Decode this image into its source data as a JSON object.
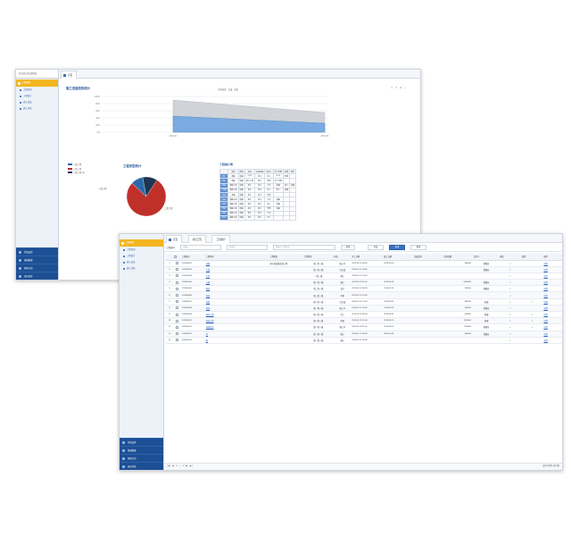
{
  "back": {
    "sidebar": {
      "header": "综合办公信息系统",
      "active": "工程管理",
      "items": [
        "工程查询",
        "工程统计",
        "施工进度",
        "施工台账"
      ],
      "bottom": [
        "系统设置",
        "基础数据",
        "帮助文档",
        "退出系统"
      ]
    },
    "tabs": [
      "首页"
    ],
    "area_chart": {
      "title": "施工进度趋势统计",
      "legend": [
        "计划进度",
        "完成",
        "实际"
      ],
      "tools": "⊙ ≡ ⊕ ⤓"
    },
    "pie": {
      "title": "工程类型统计",
      "legend": [
        "一类工程",
        "二类工程",
        "三类工程 (1)"
      ],
      "labels": [
        "一类工程",
        "二类工程"
      ]
    },
    "table": {
      "title": "工程统计表",
      "headers": [
        "",
        "名称",
        "类型",
        "状态",
        "完成金额",
        "负责人",
        "生产日期",
        "创建",
        "操作"
      ],
      "rows": [
        [
          "工程一",
          "道路",
          "道路",
          "2019",
          "施工",
          "张三",
          "2019",
          "创建",
          ""
        ],
        [
          "工程二",
          "道路",
          "道路",
          "施工工程",
          "施工",
          "李四",
          "生产日期",
          "",
          ""
        ],
        [
          "工程三",
          "道路工程",
          "道路",
          "施工",
          "施工",
          "王五",
          "道路",
          "施工",
          "道路"
        ],
        [
          "工程四",
          "道路工程",
          "道路",
          "施工",
          "施工",
          "张三",
          "施工",
          "道路",
          ""
        ],
        [
          "工程五",
          "道路",
          "道路",
          "施工",
          "施工",
          "李四",
          "",
          "",
          ""
        ],
        [
          "工程六",
          "道路工程",
          "道路",
          "施工",
          "施工",
          "王五",
          "道路",
          "",
          ""
        ],
        [
          "工程七",
          "道路工程",
          "道路",
          "施工",
          "施工",
          "张三",
          "道路",
          "",
          ""
        ],
        [
          "工程八",
          "道路工程",
          "道路",
          "施工",
          "施工",
          "李四",
          "道路",
          "",
          ""
        ],
        [
          "工程九",
          "道路工程",
          "道路",
          "施工",
          "施工",
          "王五",
          "",
          "",
          ""
        ],
        [
          "工程十",
          "道路工程",
          "道路",
          "施工",
          "施工",
          "张三",
          "",
          "",
          ""
        ]
      ]
    }
  },
  "front": {
    "sidebar": {
      "active": "工程管理",
      "items": [
        "工程查询",
        "工程统计",
        "施工进度",
        "施工台账"
      ],
      "bottom": [
        "系统设置",
        "基础数据",
        "帮助文档",
        "退出系统"
      ]
    },
    "tabs": [
      "首页",
      "项目工程",
      "工程统计"
    ],
    "toolbar": {
      "label": "工程编号",
      "input1": "请输入",
      "input2": "请选择",
      "input3": "请输入工程名称",
      "btn1": "查询",
      "btn2": "导出",
      "btn3": "新增",
      "btn4": "更多"
    },
    "grid": {
      "headers": [
        "",
        "",
        "工程编号",
        "工程名称",
        "",
        "工程地址",
        "工程类型",
        "状态",
        "开工日期",
        "竣工日期",
        "完成日期",
        "合同金额",
        "负责人",
        "审核",
        "验收",
        "操作"
      ],
      "rows": [
        [
          "1",
          "201900001",
          "道路",
          "南大桥道路改造工程",
          "第一类一级",
          "施工中",
          "2019-01-10 08:00",
          "2019-06-30",
          "",
          "980000",
          "管理员",
          "✓",
          "",
          "详情"
        ],
        [
          "2",
          "201900002",
          "大桥",
          "",
          "第一类一级",
          "已完成",
          "2019-01-11 09:00",
          "",
          "",
          "",
          "管理员",
          "✓",
          "",
          "详情"
        ],
        [
          "3",
          "201900003",
          "水利",
          "",
          "一类一级",
          "施工",
          "2019-01-12 10:00",
          "",
          "",
          "",
          "",
          "✓",
          "",
          "详情"
        ],
        [
          "4",
          "201900004",
          "公路",
          "",
          "第一类一级",
          "施工",
          "2019-01-13 11:00",
          "2019-06-30",
          "",
          "2300000",
          "管理员",
          "✓",
          "",
          "详情"
        ],
        [
          "5",
          "201900005",
          "隧道",
          "",
          "第二类一级",
          "设计",
          "2019-01-14 08:30",
          "2019-07-01",
          "",
          "560000",
          "管理员",
          "✓",
          "",
          "详情"
        ],
        [
          "6",
          "201900006",
          "桥梁",
          "",
          "第二类一级",
          "待审",
          "2019-01-15 14:00",
          "",
          "",
          "",
          "",
          "✓",
          "",
          "详情"
        ],
        [
          "7",
          "201900007",
          "道路",
          "",
          "第一类一级",
          "已完成",
          "2019-01-16 15:00",
          "2019-08-01",
          "",
          "880000",
          "普通",
          "✓",
          "✓",
          "详情"
        ],
        [
          "8",
          "201900008",
          "管道",
          "",
          "第一类一级",
          "施工中",
          "2019-01-17 16:00",
          "2019-08-15",
          "",
          "420000",
          "管理员",
          "✓",
          "",
          "详情"
        ],
        [
          "9",
          "201900009",
          "绿化工程",
          "",
          "第一类一级",
          "完工",
          "2019-01-18 09:00",
          "2019-09-01",
          "",
          "330000",
          "普通",
          "✓",
          "✓",
          "详情"
        ],
        [
          "10",
          "201900010",
          "改造工程",
          "",
          "第一类一级",
          "审核",
          "2019-01-19 10:00",
          "2019-09-10",
          "",
          "1200000",
          "普通",
          "✓",
          "✓",
          "详情"
        ],
        [
          "11",
          "201900011",
          "道路改造",
          "",
          "第一类一级",
          "施工中",
          "2019-01-20 11:00",
          "2019-09-20",
          "",
          "7700000",
          "管理员",
          "✓",
          "✓",
          "详情"
        ],
        [
          "12",
          "201900012",
          "桥",
          "",
          "第一类一级",
          "施工",
          "2019-01-21 08:00",
          "2019-10-01",
          "",
          "450000",
          "管理员",
          "✓",
          "",
          "详情"
        ],
        [
          "13",
          "201900013",
          "路",
          "",
          "第一类一级",
          "施工",
          "2019-01-22 08:00",
          "",
          "",
          "",
          "",
          "✓",
          "",
          "详情"
        ]
      ]
    },
    "pager": {
      "nav": "|◀ ◀ 1 / 1 ▶ ▶|",
      "info": "显示1到13,共13条"
    }
  },
  "chart_data": [
    {
      "type": "area",
      "title": "施工进度趋势统计",
      "x": [
        "2019-01",
        "2019-06"
      ],
      "series": [
        {
          "name": "计划进度",
          "values": [
            90,
            55
          ]
        },
        {
          "name": "完成",
          "values": [
            45,
            25
          ]
        }
      ],
      "ylim": [
        0,
        100
      ],
      "yticks": [
        "100%",
        "80%",
        "60%",
        "40%",
        "20%",
        "0%"
      ],
      "grid": true,
      "legend": "top"
    },
    {
      "type": "pie",
      "title": "工程类型统计",
      "categories": [
        "二类工程",
        "一类工程",
        "三类工程"
      ],
      "values": [
        78,
        10,
        12
      ],
      "legend": "left"
    }
  ],
  "colors": {
    "accent": "#f3b620",
    "primary": "#1d4f94",
    "link": "#2a66c2",
    "area_top": "#d0d3d8",
    "area_bottom": "#7aaadf",
    "pie_main": "#c0302a",
    "pie_a": "#2a6aa8",
    "pie_b": "#1e3550"
  }
}
